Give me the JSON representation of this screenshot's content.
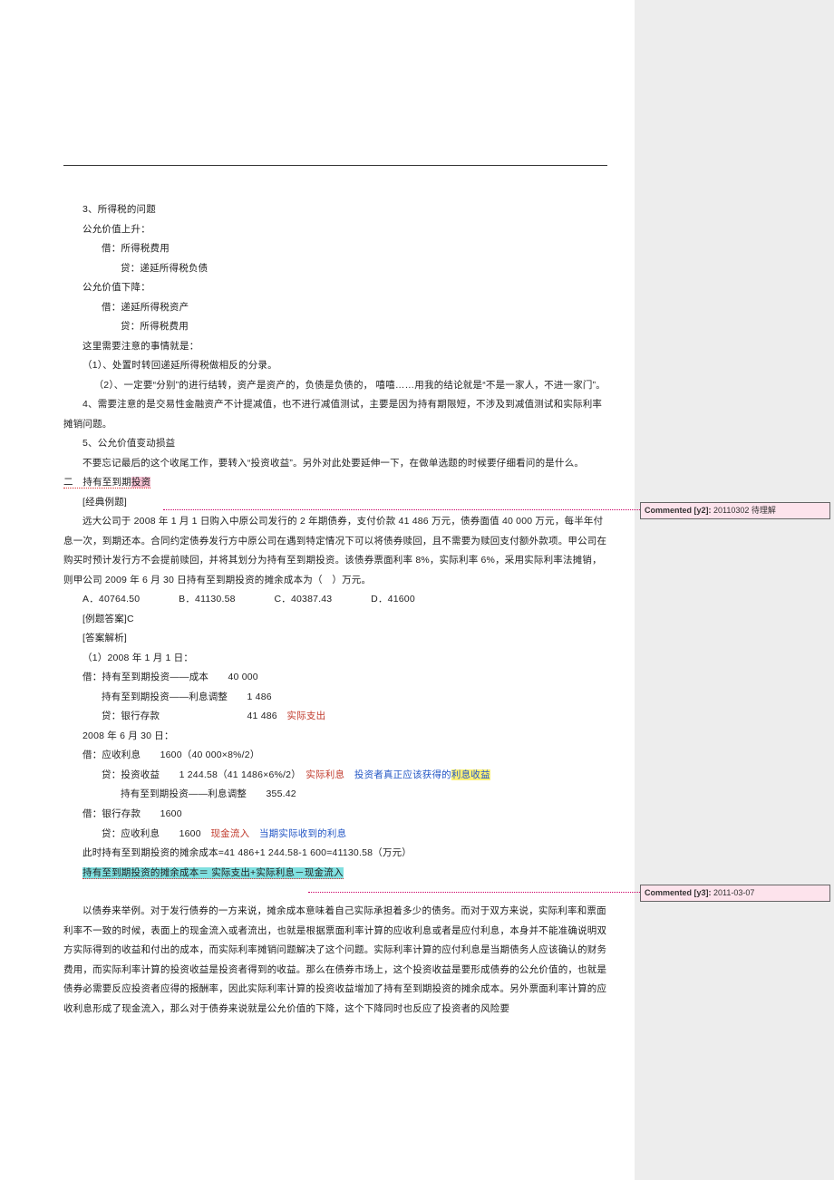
{
  "lines": {
    "l01": "3、所得税的问题",
    "l02": "公允价值上升：",
    "l03": "借：所得税费用",
    "l04": "贷：递延所得税负债",
    "l05": "公允价值下降：",
    "l06": "借：递延所得税资产",
    "l07": "贷：所得税费用",
    "l08": "这里需要注意的事情就是：",
    "l09": "（1）、处置时转回递延所得税做相反的分录。",
    "l10": "（2）、一定要“分别”的进行结转，资产是资产的，负债是负债的，  嘻嘻……用我的结论就是“不是一家人，不进一家门”。",
    "l11": "4、需要注意的是交易性金融资产不计提减值，也不进行减值测试，主要是因为持有期限短，不涉及到减值测试和实际利率摊销问题。",
    "l12": "5、公允价值变动损益",
    "l13": "不要忘记最后的这个收尾工作，要转入“投资收益”。另外对此处要延伸一下，在做单选题的时候要仔细看问的是什么。",
    "sec2_a": "二　持有至到期",
    "sec2_b": "投资",
    "l14": "[经典例题]",
    "l15": "远大公司于 2008 年 1 月 1 日购入中原公司发行的 2 年期债券，支付价款 41 486 万元，债券面值 40 000 万元，每半年付息一次，到期还本。合同约定债券发行方中原公司在遇到特定情况下可以将债券赎回，且不需要为赎回支付额外款项。甲公司在购买时预计发行方不会提前赎回，并将其划分为持有至到期投资。该债券票面利率 8%，实际利率 6%，采用实际利率法摊销，则甲公司 2009 年 6 月 30 日持有至到期投资的摊余成本为（　）万元。",
    "optA": "A．40764.50",
    "optB": "B．41130.58",
    "optC": "C．40387.43",
    "optD": "D．41600",
    "l16": "[例题答案]C",
    "l17": "[答案解析]",
    "l18": "（1）2008 年 1 月 1 日：",
    "l19": "借：持有至到期投资——成本　　40 000",
    "l20": "持有至到期投资——利息调整　　1 486",
    "l21a": "贷：银行存款　　　　　　　　　41 486",
    "l21b": "实际支出",
    "l22": "2008 年 6 月 30 日：",
    "l23": "借：应收利息　　1600（40 000×8%/2）",
    "l24a": "贷：投资收益　　1 244.58（41 1486×6%/2）",
    "l24b": "实际利息",
    "l24c": "投资者真正应该获得的",
    "l24d": "利息收益",
    "l25": "持有至到期投资——利息调整　　355.42",
    "l26": "借：银行存款　　1600",
    "l27a": "贷：应收利息　　1600",
    "l27b": "现金流入",
    "l27c": "当期实际收到的利息",
    "l28": "此时持有至到期投资的摊余成本=41 486+1 244.58-1 600=41130.58（万元）",
    "l29": "持有至到期投资的摊余成本＝ 实际支出+实际利息－现金流入",
    "l30": "以债券来举例。对于发行债券的一方来说，摊余成本意味着自己实际承担着多少的债务。而对于双方来说，实际利率和票面利率不一致的时候，表面上的现金流入或者流出，也就是根据票面利率计算的应收利息或者是应付利息，本身并不能准确说明双方实际得到的收益和付出的成本，而实际利率摊销问题解决了这个问题。实际利率计算的应付利息是当期债务人应该确认的财务费用，而实际利率计算的投资收益是投资者得到的收益。那么在债券市场上，这个投资收益是要形成债券的公允价值的，也就是债券必需要反应投资者应得的报酬率，因此实际利率计算的投资收益增加了持有至到期投资的摊余成本。另外票面利率计算的应收利息形成了现金流入，那么对于债券来说就是公允价值的下降，这个下降同时也反应了投资者的风险要"
  },
  "comments": {
    "c1_label": "Commented [y2]:",
    "c1_text": " 20110302 待理解",
    "c2_label": "Commented [y3]:",
    "c2_text": " 2011-03-07"
  }
}
